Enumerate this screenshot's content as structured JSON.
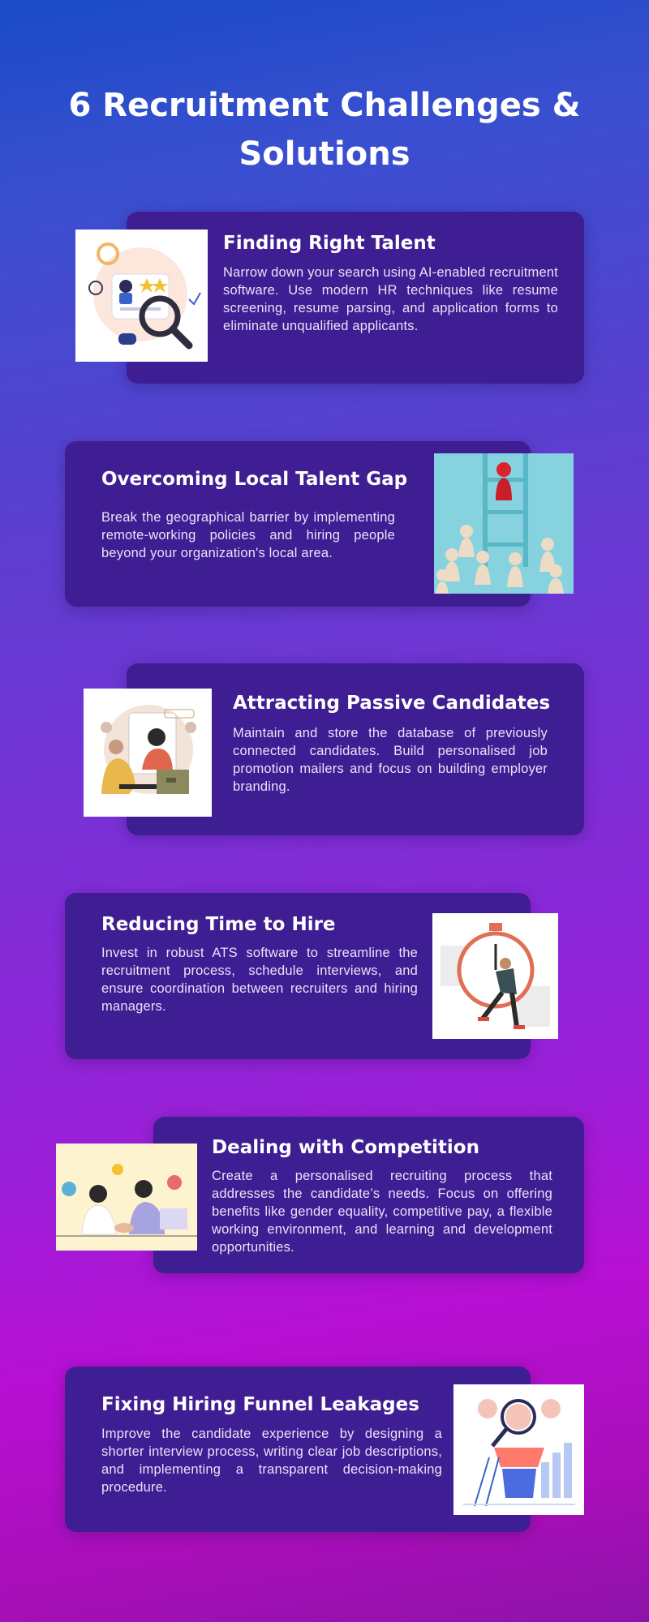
{
  "page": {
    "title": "6 Recruitment Challenges & Solutions"
  },
  "cards": [
    {
      "heading": "Finding Right Talent",
      "body": "Narrow down your search using AI-enabled recruitment software. Use modern HR techniques like resume screening, resume parsing, and application forms to eliminate unqualified applicants.",
      "image_icon": "magnifier-candidate-icon"
    },
    {
      "heading": "Overcoming Local Talent Gap",
      "body": "Break the geographical barrier by implementing remote-working policies and hiring people beyond your organization's local area.",
      "image_icon": "ladder-pawns-icon"
    },
    {
      "heading": "Attracting Passive Candidates",
      "body": "Maintain and store the database of previously connected candidates. Build personalised job promotion mailers and focus on building employer branding.",
      "image_icon": "people-laptop-icon"
    },
    {
      "heading": "Reducing Time to Hire",
      "body": "Invest in robust ATS software to streamline the recruitment process, schedule interviews, and ensure coordination between recruiters and hiring managers.",
      "image_icon": "stopwatch-runner-icon"
    },
    {
      "heading": "Dealing with Competition",
      "body": "Create a personalised recruiting process that addresses the candidate’s needs. Focus on offering benefits like gender equality, competitive pay, a flexible working environment, and learning and development opportunities.",
      "image_icon": "handshake-icon"
    },
    {
      "heading": "Fixing Hiring Funnel Leakages",
      "body": "Improve the candidate experience by designing a shorter interview process, writing clear job descriptions, and implementing a transparent decision-making procedure.",
      "image_icon": "funnel-magnifier-icon"
    }
  ],
  "colors": {
    "card_bg": "#3f1d92",
    "text": "#ffffff"
  }
}
